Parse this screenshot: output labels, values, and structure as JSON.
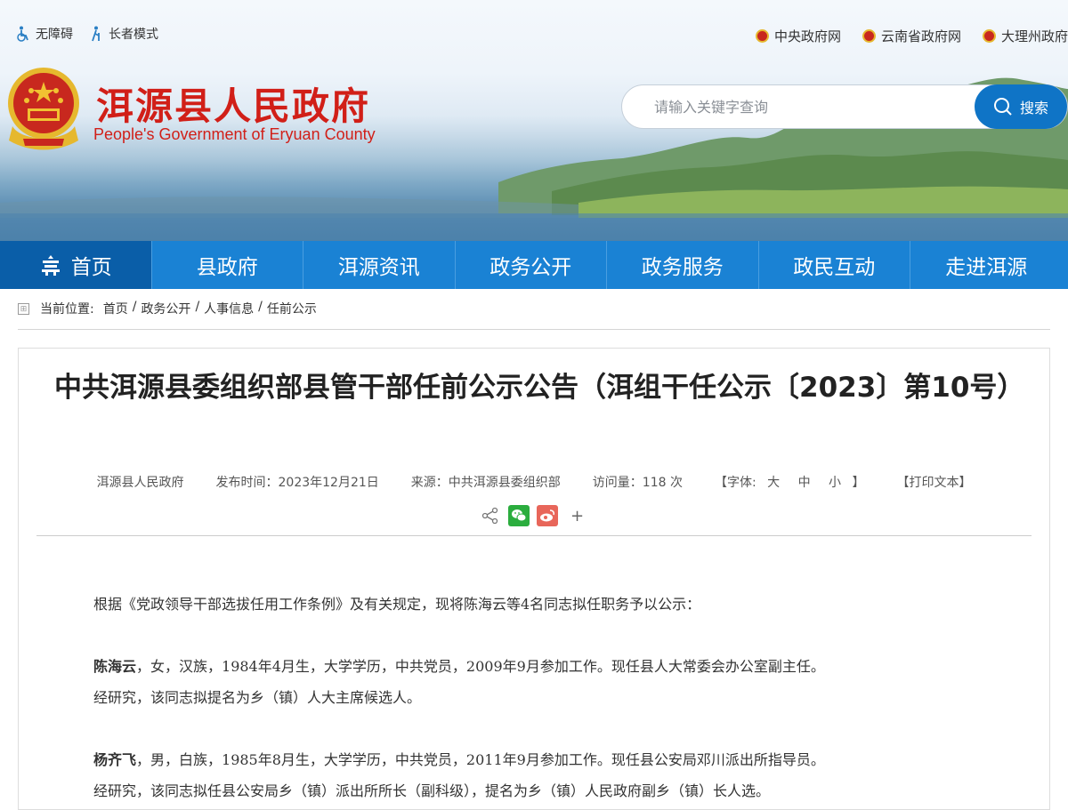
{
  "header": {
    "accessibility": [
      {
        "label": "无障碍",
        "icon": "wheelchair-icon"
      },
      {
        "label": "长者模式",
        "icon": "elderly-icon"
      }
    ],
    "gov_links": [
      {
        "label": "中央政府网",
        "icon": "national-emblem-icon"
      },
      {
        "label": "云南省政府网",
        "icon": "national-emblem-icon"
      },
      {
        "label": "大理州政府",
        "icon": "national-emblem-icon"
      }
    ],
    "site_title": "洱源县人民政府",
    "site_subtitle": "People's Government of Eryuan County",
    "search": {
      "placeholder": "请输入关键字查询",
      "value": "",
      "button_label": "搜索"
    }
  },
  "nav": {
    "items": [
      {
        "label": "首页",
        "active": true,
        "icon": "home-icon"
      },
      {
        "label": "县政府"
      },
      {
        "label": "洱源资讯"
      },
      {
        "label": "政务公开"
      },
      {
        "label": "政务服务"
      },
      {
        "label": "政民互动"
      },
      {
        "label": "走进洱源"
      }
    ]
  },
  "breadcrumb": {
    "prefix": "当前位置:",
    "items": [
      "首页",
      "政务公开",
      "人事信息",
      "任前公示"
    ],
    "separator": "/"
  },
  "article": {
    "title": "中共洱源县委组织部县管干部任前公示公告（洱组干任公示〔2023〕第10号）",
    "meta": {
      "publisher": "洱源县人民政府",
      "publish_time": "发布时间：2023年12月21日",
      "source": "来源：中共洱源县委组织部",
      "views": "访问量：118 次",
      "font_label_open": "【字体:",
      "font_large": "大",
      "font_medium": "中",
      "font_small": "小",
      "font_label_close": "】",
      "print": "【打印文本】"
    },
    "share": {
      "plus": "+"
    },
    "intro": "根据《党政领导干部选拔任用工作条例》及有关规定，现将陈海云等4名同志拟任职务予以公示：",
    "persons": [
      {
        "name": "陈海云",
        "line1": "，女，汉族，1984年4月生，大学学历，中共党员，2009年9月参加工作。现任县人大常委会办公室副主任。",
        "line2": "经研究，该同志拟提名为乡（镇）人大主席候选人。"
      },
      {
        "name": "杨齐飞",
        "line1": "，男，白族，1985年8月生，大学学历，中共党员，2011年9月参加工作。现任县公安局邓川派出所指导员。",
        "line2": "经研究，该同志拟任县公安局乡（镇）派出所所长（副科级），提名为乡（镇）人民政府副乡（镇）长人选。"
      }
    ]
  },
  "colors": {
    "nav": "#1a82d4",
    "nav_active": "#0a5ea8",
    "title_red": "#d11f18",
    "search_button": "#0f74c6",
    "wechat": "#2bad3e",
    "weibo": "#e8665a"
  }
}
